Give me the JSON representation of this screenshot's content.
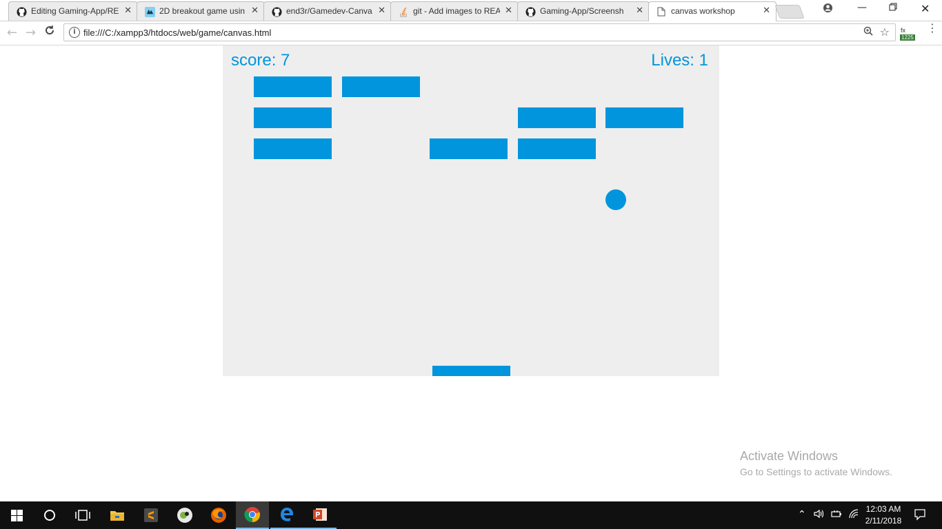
{
  "browser": {
    "tabs": [
      {
        "title": "Editing Gaming-App/RE",
        "icon": "github-icon"
      },
      {
        "title": "2D breakout game usin",
        "icon": "mdn-icon"
      },
      {
        "title": "end3r/Gamedev-Canva",
        "icon": "github-icon"
      },
      {
        "title": "git - Add images to REA",
        "icon": "stackoverflow-icon"
      },
      {
        "title": "Gaming-App/Screensh",
        "icon": "github-icon"
      },
      {
        "title": "canvas workshop",
        "icon": "page-icon",
        "active": true
      }
    ],
    "url": "file:///C:/xampp3/htdocs/web/game/canvas.html",
    "extension_label": "fx",
    "extension_badge": "1225"
  },
  "game": {
    "score_text": "score: 7",
    "lives_text": "Lives: 1",
    "score": 7,
    "lives": 1,
    "brick_color": "#0095DD",
    "background_color": "#eeeeee",
    "bricks": [
      {
        "col": 0,
        "row": 0
      },
      {
        "col": 1,
        "row": 0
      },
      {
        "col": 0,
        "row": 1
      },
      {
        "col": 3,
        "row": 1
      },
      {
        "col": 4,
        "row": 1
      },
      {
        "col": 0,
        "row": 2
      },
      {
        "col": 2,
        "row": 2
      },
      {
        "col": 3,
        "row": 2
      }
    ]
  },
  "watermark": {
    "title": "Activate Windows",
    "subtitle": "Go to Settings to activate Windows."
  },
  "taskbar": {
    "apps": [
      "start-icon",
      "search-icon",
      "task-view-icon",
      "file-explorer-icon",
      "sublime-text-icon",
      "app-icon",
      "firefox-icon",
      "chrome-icon",
      "edge-icon",
      "powerpoint-icon"
    ],
    "time": "12:03 AM",
    "date": "2/11/2018"
  }
}
